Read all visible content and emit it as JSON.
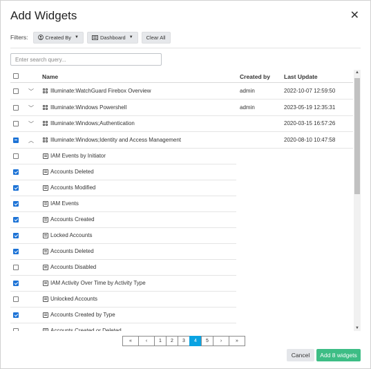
{
  "title": "Add Widgets",
  "filters": {
    "label": "Filters:",
    "created_by": "Created By",
    "dashboard": "Dashboard",
    "clear_all": "Clear All"
  },
  "search": {
    "placeholder": "Enter search query..."
  },
  "columns": {
    "name": "Name",
    "created_by": "Created by",
    "last_update": "Last Update"
  },
  "groups": [
    {
      "name": "Illuminate:WatchGuard Firebox Overview",
      "created_by": "admin",
      "last_update": "2022-10-07 12:59:50",
      "expanded": false,
      "state": "unchecked"
    },
    {
      "name": "Illuminate:Windows Powershell",
      "created_by": "admin",
      "last_update": "2023-05-19 12:35:31",
      "expanded": false,
      "state": "unchecked"
    },
    {
      "name": "Illuminate:Windows;Authentication",
      "created_by": "",
      "last_update": "2020-03-15 16:57:26",
      "expanded": false,
      "state": "unchecked"
    },
    {
      "name": "Illuminate:Windows;Identity and Access Management",
      "created_by": "",
      "last_update": "2020-08-10 10:47:58",
      "expanded": true,
      "state": "partial"
    }
  ],
  "children": [
    {
      "name": "IAM Events by Initiator",
      "checked": false
    },
    {
      "name": "Accounts Deleted",
      "checked": true
    },
    {
      "name": "Accounts Modified",
      "checked": true
    },
    {
      "name": "IAM Events",
      "checked": true
    },
    {
      "name": "Accounts Created",
      "checked": true
    },
    {
      "name": "Locked Accounts",
      "checked": true
    },
    {
      "name": "Accounts Deleted",
      "checked": true
    },
    {
      "name": "Accounts Disabled",
      "checked": false
    },
    {
      "name": "IAM Activity Over Time by Activity Type",
      "checked": true
    },
    {
      "name": "Unlocked Accounts",
      "checked": false
    },
    {
      "name": "Accounts Created by Type",
      "checked": true
    },
    {
      "name": "Accounts Created or Deleted",
      "checked": false
    }
  ],
  "pagination": {
    "first": "«",
    "prev": "‹",
    "next": "›",
    "last": "»",
    "pages": [
      "1",
      "2",
      "3",
      "4",
      "5"
    ],
    "current": "4"
  },
  "buttons": {
    "cancel": "Cancel",
    "add": "Add 8 widgets"
  },
  "colors": {
    "accent": "#1d73d6",
    "primary_button": "#3dbd85",
    "active_page": "#0aa3e2"
  }
}
